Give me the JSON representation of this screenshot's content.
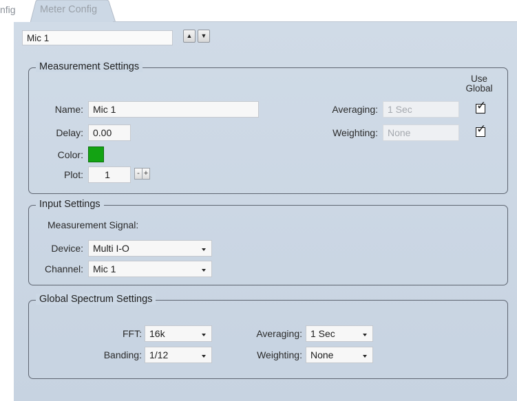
{
  "tabs": {
    "prev_label": "nfig",
    "active_label": "Meter Config"
  },
  "top": {
    "meter_name": "Mic 1"
  },
  "measurement": {
    "legend": "Measurement Settings",
    "use_global": "Use Global",
    "name_label": "Name:",
    "name_value": "Mic 1",
    "delay_label": "Delay:",
    "delay_value": "0.00",
    "color_label": "Color:",
    "color_value": "#13a313",
    "plot_label": "Plot:",
    "plot_value": "1",
    "averaging_label": "Averaging:",
    "averaging_value": "1 Sec",
    "weighting_label": "Weighting:",
    "weighting_value": "None",
    "averaging_use_global": true,
    "weighting_use_global": true
  },
  "input": {
    "legend": "Input Settings",
    "signal_label": "Measurement Signal:",
    "device_label": "Device:",
    "device_value": "Multi I-O",
    "channel_label": "Channel:",
    "channel_value": "Mic 1"
  },
  "global": {
    "legend": "Global Spectrum Settings",
    "fft_label": "FFT:",
    "fft_value": "16k",
    "banding_label": "Banding:",
    "banding_value": "1/12",
    "averaging_label": "Averaging:",
    "averaging_value": "1 Sec",
    "weighting_label": "Weighting:",
    "weighting_value": "None"
  }
}
